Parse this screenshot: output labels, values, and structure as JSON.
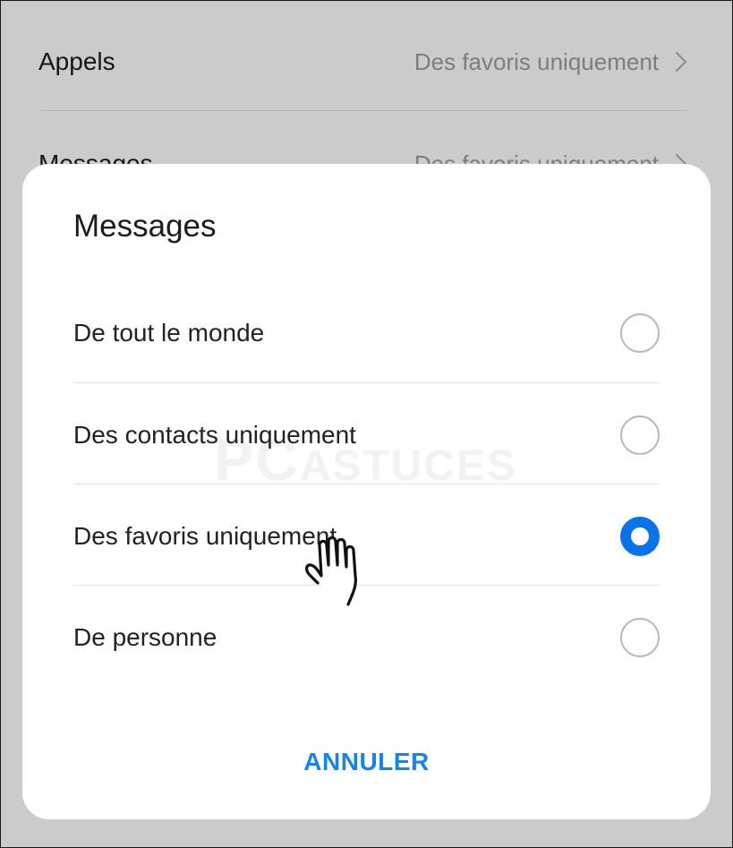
{
  "background": {
    "rows": [
      {
        "label": "Appels",
        "value": "Des favoris uniquement"
      },
      {
        "label": "Messages",
        "value": "Des favoris uniquement"
      }
    ]
  },
  "dialog": {
    "title": "Messages",
    "options": [
      {
        "label": "De tout le monde",
        "selected": false
      },
      {
        "label": "Des contacts uniquement",
        "selected": false
      },
      {
        "label": "Des favoris uniquement",
        "selected": true
      },
      {
        "label": "De personne",
        "selected": false
      }
    ],
    "cancel_label": "ANNULER"
  },
  "watermark": {
    "big": "PC",
    "small": "ASTUCES"
  },
  "icons": {
    "chevron": "chevron-right-icon",
    "radio": "radio-button-icon",
    "cursor": "hand-pointer-icon"
  },
  "colors": {
    "accent": "#0a73ea",
    "cancel_text": "#1684e8",
    "background_dim": "#cbcbcb"
  }
}
